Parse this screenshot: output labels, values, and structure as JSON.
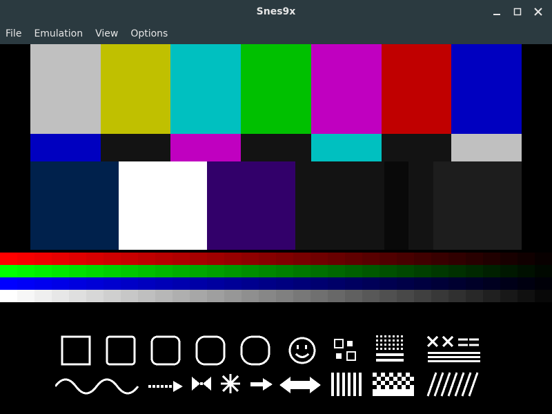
{
  "window": {
    "title": "Snes9x"
  },
  "menu": {
    "file": "File",
    "emulation": "Emulation",
    "view": "View",
    "options": "Options"
  },
  "test_pattern": {
    "row1_colors": [
      "#C0C0C0",
      "#C0C000",
      "#00C0C0",
      "#00C000",
      "#C000C0",
      "#C00000",
      "#0000C0"
    ],
    "row2_colors": [
      "#0000C0",
      "#131313",
      "#C000C0",
      "#131313",
      "#00C0C0",
      "#131313",
      "#C0C0C0"
    ],
    "row3_colors": [
      "#00214C",
      "#FFFFFF",
      "#32006A",
      "#131313",
      "#090909",
      "#131313",
      "#1D1D1D"
    ],
    "row3_widths": [
      18,
      18,
      18,
      18,
      5,
      5,
      18
    ],
    "gradients": [
      {
        "color": [
          255,
          0,
          0
        ]
      },
      {
        "color": [
          0,
          255,
          0
        ]
      },
      {
        "color": [
          0,
          0,
          255
        ]
      },
      {
        "color": [
          255,
          255,
          255
        ]
      }
    ],
    "gradient_steps": 32
  }
}
